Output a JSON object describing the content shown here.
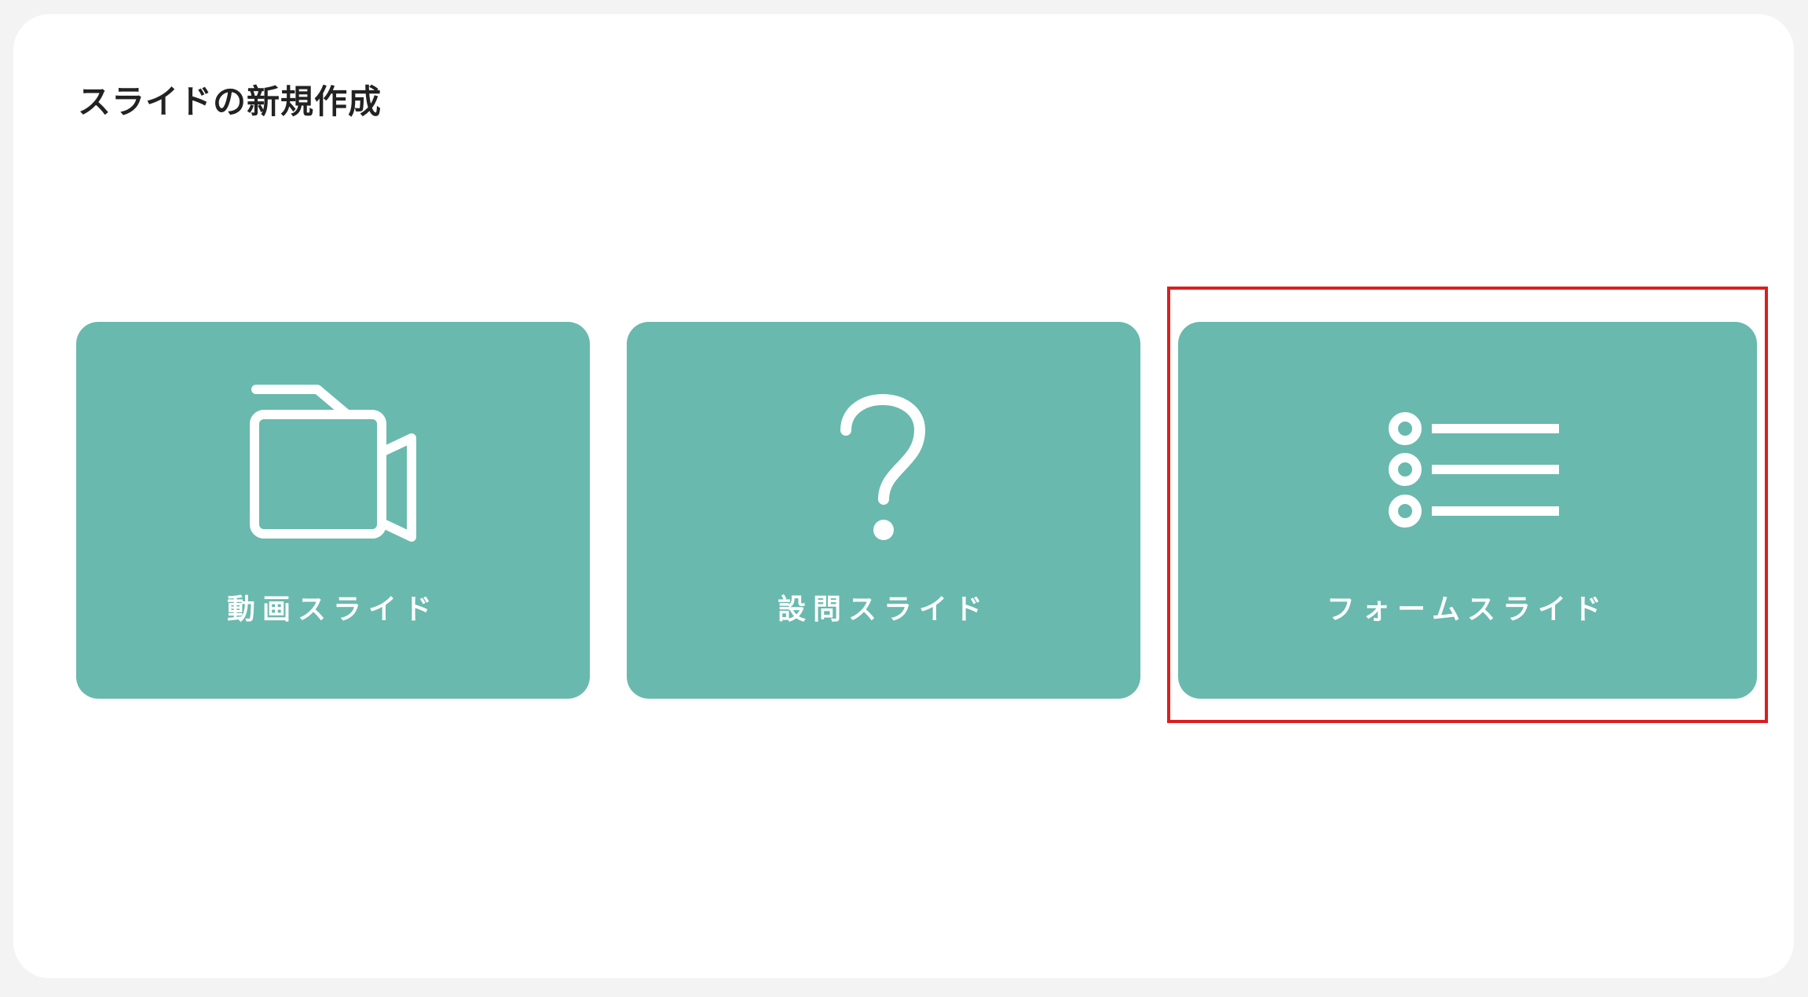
{
  "page": {
    "title": "スライドの新規作成"
  },
  "cards": {
    "video": {
      "label": "動画スライド",
      "icon": "video-camera-icon"
    },
    "question": {
      "label": "設問スライド",
      "icon": "question-mark-icon"
    },
    "form": {
      "label": "フォームスライド",
      "icon": "list-icon"
    }
  },
  "colors": {
    "card": "#69b9ae",
    "background": "#f3f3f3",
    "panel": "#ffffff",
    "highlight": "#dc1e1e"
  }
}
